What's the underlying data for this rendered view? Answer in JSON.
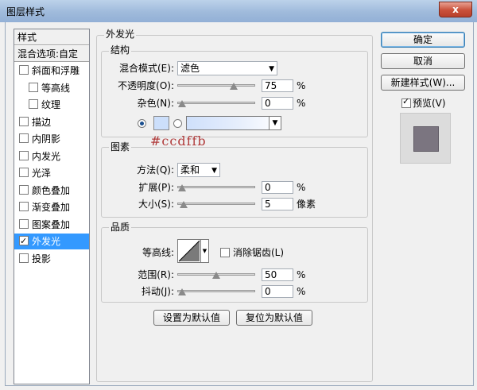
{
  "window": {
    "title": "图层样式",
    "close": "x"
  },
  "style_list": {
    "header": "样式",
    "blend_options": "混合选项:自定",
    "items": [
      {
        "label": "斜面和浮雕",
        "checked": false,
        "indent": false
      },
      {
        "label": "等高线",
        "checked": false,
        "indent": true
      },
      {
        "label": "纹理",
        "checked": false,
        "indent": true
      },
      {
        "label": "描边",
        "checked": false,
        "indent": false
      },
      {
        "label": "内阴影",
        "checked": false,
        "indent": false
      },
      {
        "label": "内发光",
        "checked": false,
        "indent": false
      },
      {
        "label": "光泽",
        "checked": false,
        "indent": false
      },
      {
        "label": "颜色叠加",
        "checked": false,
        "indent": false
      },
      {
        "label": "渐变叠加",
        "checked": false,
        "indent": false
      },
      {
        "label": "图案叠加",
        "checked": false,
        "indent": false
      },
      {
        "label": "外发光",
        "checked": true,
        "indent": false,
        "selected": true
      },
      {
        "label": "投影",
        "checked": false,
        "indent": false
      }
    ]
  },
  "outer_glow": {
    "title": "外发光",
    "structure": {
      "title": "结构",
      "blend_mode_label": "混合模式(E):",
      "blend_mode_value": "滤色",
      "opacity_label": "不透明度(O):",
      "opacity_value": "75",
      "opacity_level": 0.75,
      "noise_label": "杂色(N):",
      "noise_value": "0",
      "noise_level": 0,
      "percent": "%",
      "glow_color": "#ccdffb",
      "color_annotation": "#ccdffb"
    },
    "elements": {
      "title": "图素",
      "technique_label": "方法(Q):",
      "technique_value": "柔和",
      "spread_label": "扩展(P):",
      "spread_value": "0",
      "spread_level": 0,
      "size_label": "大小(S):",
      "size_value": "5",
      "size_level": 0.02,
      "percent": "%",
      "pixels": "像素"
    },
    "quality": {
      "title": "品质",
      "contour_label": "等高线:",
      "antialias_label": "消除锯齿(L)",
      "antialias_checked": false,
      "range_label": "范围(R):",
      "range_value": "50",
      "range_level": 0.5,
      "jitter_label": "抖动(J):",
      "jitter_value": "0",
      "jitter_level": 0,
      "percent": "%"
    },
    "make_default": "设置为默认值",
    "reset_default": "复位为默认值"
  },
  "buttons": {
    "ok": "确定",
    "cancel": "取消",
    "new_style": "新建样式(W)...",
    "preview_label": "预览(V)",
    "preview_checked": true
  },
  "colors": {
    "accent": "#3399ff",
    "annotation": "#b03a3a",
    "preview_swatch": "#7b7580"
  }
}
